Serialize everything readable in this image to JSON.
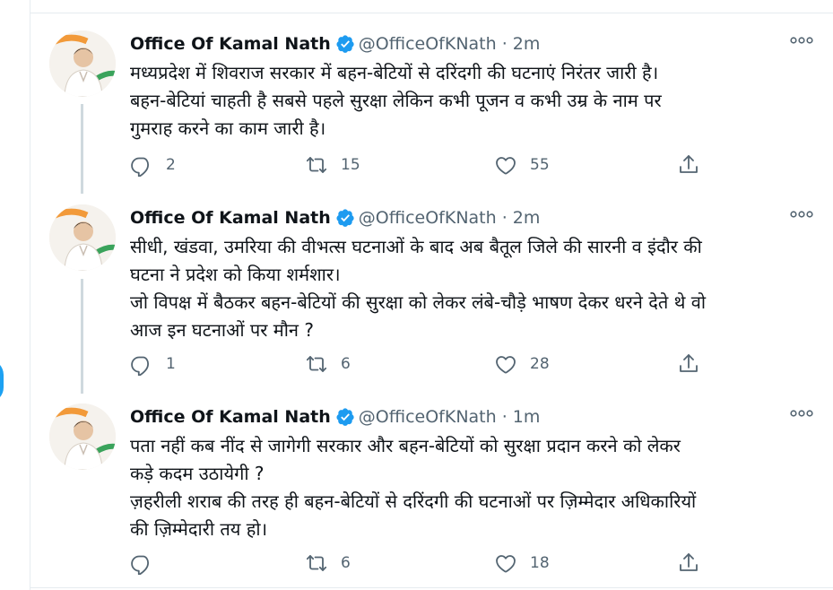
{
  "tweets": [
    {
      "name": "Office Of Kamal Nath",
      "handle": "@OfficeOfKNath",
      "dot": "·",
      "time": "2m",
      "lines": [
        "मध्यप्रदेश में शिवराज सरकार में बहन-बेटियों से दरिंदगी की घटनाएं निरंतर जारी है।",
        "बहन-बेटियां चाहती है सबसे पहले सुरक्षा लेकिन कभी पूजन व कभी उम्र के नाम पर",
        "गुमराह करने का काम जारी है।"
      ],
      "replies": "2",
      "retweets": "15",
      "likes": "55"
    },
    {
      "name": "Office Of Kamal Nath",
      "handle": "@OfficeOfKNath",
      "dot": "·",
      "time": "2m",
      "lines": [
        "सीधी, खंडवा, उमरिया की वीभत्स घटनाओं के बाद अब बैतूल जिले की सारनी व इंदौर की",
        "घटना ने प्रदेश को किया शर्मशार।",
        "जो विपक्ष में बैठकर बहन-बेटियों की सुरक्षा को लेकर लंबे-चौड़े भाषण देकर धरने देते थे वो",
        "आज इन घटनाओं पर मौन ?"
      ],
      "replies": "1",
      "retweets": "6",
      "likes": "28"
    },
    {
      "name": "Office Of Kamal Nath",
      "handle": "@OfficeOfKNath",
      "dot": "·",
      "time": "1m",
      "lines": [
        "पता नहीं कब नींद से जागेगी सरकार और बहन-बेटियों को सुरक्षा प्रदान करने को लेकर",
        "कड़े कदम उठायेगी ?",
        "ज़हरीली शराब की तरह ही बहन-बेटियों से दरिंदगी की घटनाओं पर ज़िम्मेदार अधिकारियों",
        "की ज़िम्मेदारी तय हो।"
      ],
      "replies": "",
      "retweets": "6",
      "likes": "18"
    }
  ],
  "icons": {
    "avatar": "avatar-portrait",
    "verified": "verified-badge-icon",
    "more": "more-options-icon",
    "reply": "reply-icon",
    "retweet": "retweet-icon",
    "like": "like-icon",
    "share": "share-icon"
  },
  "colors": {
    "accent": "#1da1f2",
    "muted_text": "#536471",
    "divider": "#e6ecf0",
    "thread_line": "#cfd9de"
  }
}
